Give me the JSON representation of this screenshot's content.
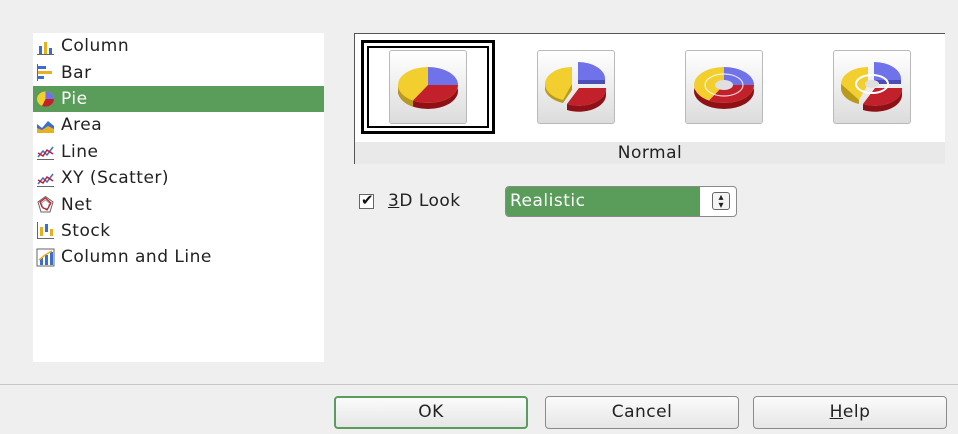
{
  "chart_types": [
    {
      "label": "Column",
      "icon": "column-chart-icon"
    },
    {
      "label": "Bar",
      "icon": "bar-chart-icon"
    },
    {
      "label": "Pie",
      "icon": "pie-chart-icon",
      "selected": true
    },
    {
      "label": "Area",
      "icon": "area-chart-icon"
    },
    {
      "label": "Line",
      "icon": "line-chart-icon"
    },
    {
      "label": "XY (Scatter)",
      "icon": "scatter-chart-icon"
    },
    {
      "label": "Net",
      "icon": "net-chart-icon"
    },
    {
      "label": "Stock",
      "icon": "stock-chart-icon"
    },
    {
      "label": "Column and Line",
      "icon": "column-line-chart-icon"
    }
  ],
  "variants": {
    "items": [
      "pie-normal-icon",
      "pie-exploded-icon",
      "donut-icon",
      "donut-exploded-icon"
    ],
    "selected_index": 0,
    "caption": "Normal"
  },
  "look": {
    "checkbox_label_key": "3",
    "checkbox_label_rest": "D Look",
    "checked": true,
    "select_value": "Realistic"
  },
  "buttons": {
    "ok": "OK",
    "cancel": "Cancel",
    "help_key": "H",
    "help_rest": "elp"
  },
  "colors": {
    "selection": "#5a9c5a",
    "pie_yellow": "#f2cf2e",
    "pie_blue": "#6f72e8",
    "pie_red": "#c2202a"
  }
}
